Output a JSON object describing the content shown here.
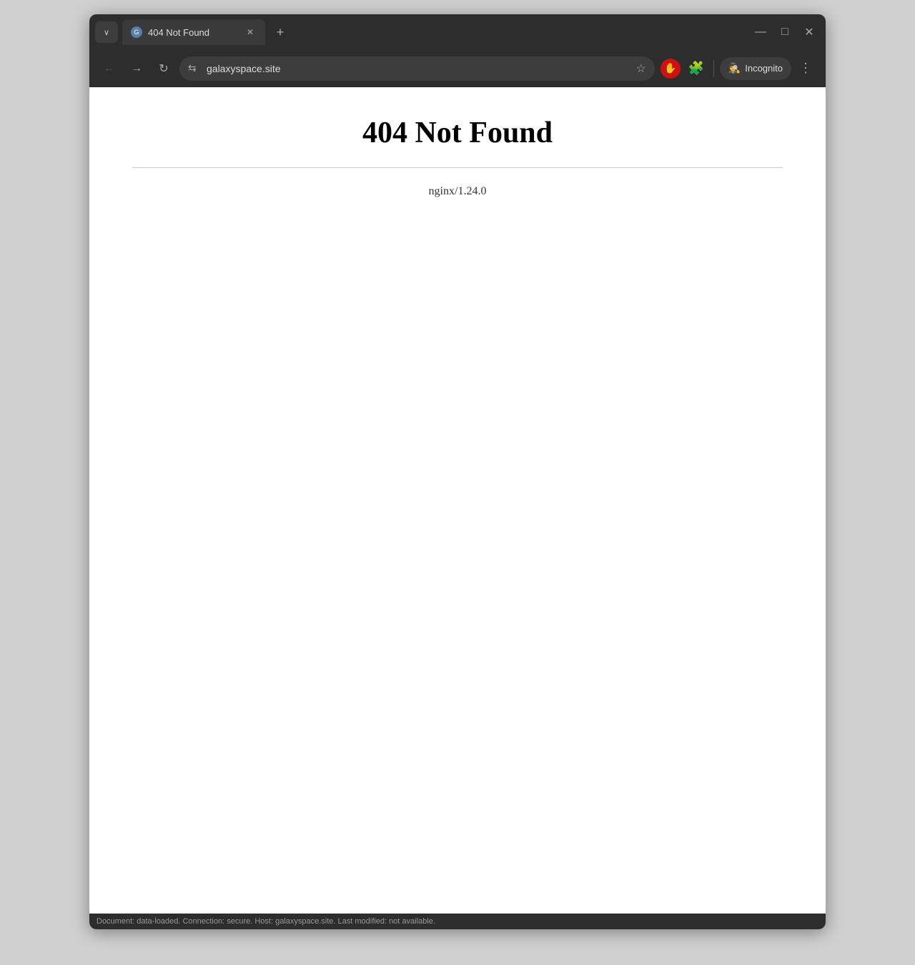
{
  "browser": {
    "tab": {
      "title": "404 Not Found",
      "favicon_label": "G"
    },
    "new_tab_label": "+",
    "window_controls": {
      "minimize": "—",
      "maximize": "□",
      "close": "✕"
    },
    "nav": {
      "back_icon": "←",
      "forward_icon": "→",
      "reload_icon": "↻",
      "address_icon": "⇆",
      "address_url": "galaxyspace.site",
      "star_icon": "☆",
      "block_icon": "✋",
      "puzzle_icon": "🧩",
      "incognito_label": "Incognito",
      "incognito_icon": "🕵",
      "menu_icon": "⋮",
      "dropdown_icon": "∨"
    }
  },
  "page": {
    "heading": "404 Not Found",
    "server_info": "nginx/1.24.0"
  },
  "status_bar": {
    "text": "Document: data-loaded. Connection: secure. Host: galaxyspace.site. Last modified: not available."
  }
}
